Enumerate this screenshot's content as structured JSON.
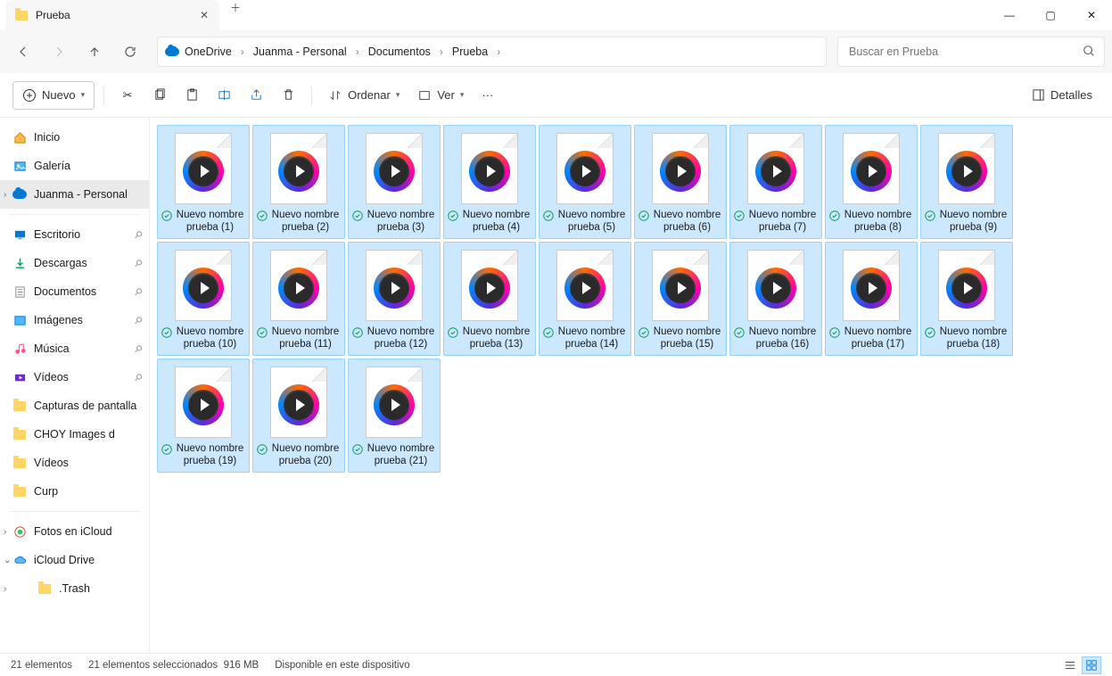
{
  "window": {
    "title": "Prueba"
  },
  "breadcrumb": [
    "OneDrive",
    "Juanma - Personal",
    "Documentos",
    "Prueba"
  ],
  "search": {
    "placeholder": "Buscar en Prueba"
  },
  "toolbar": {
    "new": "Nuevo",
    "sort": "Ordenar",
    "view": "Ver",
    "details": "Detalles"
  },
  "sidebar": {
    "top": [
      {
        "label": "Inicio",
        "icon": "home"
      },
      {
        "label": "Galería",
        "icon": "gallery"
      },
      {
        "label": "Juanma - Personal",
        "icon": "cloud",
        "active": true,
        "expand": true
      }
    ],
    "quick": [
      {
        "label": "Escritorio",
        "icon": "desktop",
        "pinned": true
      },
      {
        "label": "Descargas",
        "icon": "download",
        "pinned": true
      },
      {
        "label": "Documentos",
        "icon": "doc",
        "pinned": true
      },
      {
        "label": "Imágenes",
        "icon": "image",
        "pinned": true
      },
      {
        "label": "Música",
        "icon": "music",
        "pinned": true
      },
      {
        "label": "Vídeos",
        "icon": "video",
        "pinned": true
      },
      {
        "label": "Capturas de pantalla",
        "icon": "folder"
      },
      {
        "label": "CHOY Images d",
        "icon": "folder"
      },
      {
        "label": "Vídeos",
        "icon": "folder"
      },
      {
        "label": "Curp",
        "icon": "folder"
      }
    ],
    "bottom": [
      {
        "label": "Fotos en iCloud",
        "icon": "icloud-photos",
        "expand": true
      },
      {
        "label": "iCloud Drive",
        "icon": "icloud",
        "expanded": true
      },
      {
        "label": ".Trash",
        "icon": "folder",
        "indent": true,
        "expand": true
      }
    ]
  },
  "files": [
    {
      "name": "Nuevo nombre prueba (1)",
      "selected": true,
      "synced": true
    },
    {
      "name": "Nuevo nombre prueba (2)",
      "selected": true,
      "synced": true
    },
    {
      "name": "Nuevo nombre prueba (3)",
      "selected": true,
      "synced": true
    },
    {
      "name": "Nuevo nombre prueba (4)",
      "selected": true,
      "synced": true
    },
    {
      "name": "Nuevo nombre prueba (5)",
      "selected": true,
      "synced": true
    },
    {
      "name": "Nuevo nombre prueba (6)",
      "selected": true,
      "synced": true
    },
    {
      "name": "Nuevo nombre prueba (7)",
      "selected": true,
      "synced": true
    },
    {
      "name": "Nuevo nombre prueba (8)",
      "selected": true,
      "synced": true
    },
    {
      "name": "Nuevo nombre prueba (9)",
      "selected": true,
      "synced": true
    },
    {
      "name": "Nuevo nombre prueba (10)",
      "selected": true,
      "synced": true
    },
    {
      "name": "Nuevo nombre prueba (11)",
      "selected": true,
      "synced": true
    },
    {
      "name": "Nuevo nombre prueba (12)",
      "selected": true,
      "synced": true
    },
    {
      "name": "Nuevo nombre prueba (13)",
      "selected": true,
      "synced": true
    },
    {
      "name": "Nuevo nombre prueba (14)",
      "selected": true,
      "synced": true
    },
    {
      "name": "Nuevo nombre prueba (15)",
      "selected": true,
      "synced": true
    },
    {
      "name": "Nuevo nombre prueba (16)",
      "selected": true,
      "synced": true
    },
    {
      "name": "Nuevo nombre prueba (17)",
      "selected": true,
      "synced": true
    },
    {
      "name": "Nuevo nombre prueba (18)",
      "selected": true,
      "synced": true
    },
    {
      "name": "Nuevo nombre prueba (19)",
      "selected": true,
      "synced": true
    },
    {
      "name": "Nuevo nombre prueba (20)",
      "selected": true,
      "synced": true
    },
    {
      "name": "Nuevo nombre prueba (21)",
      "selected": true,
      "synced": true
    }
  ],
  "status": {
    "count": "21 elementos",
    "selected": "21 elementos seleccionados",
    "size": "916 MB",
    "availability": "Disponible en este dispositivo"
  }
}
